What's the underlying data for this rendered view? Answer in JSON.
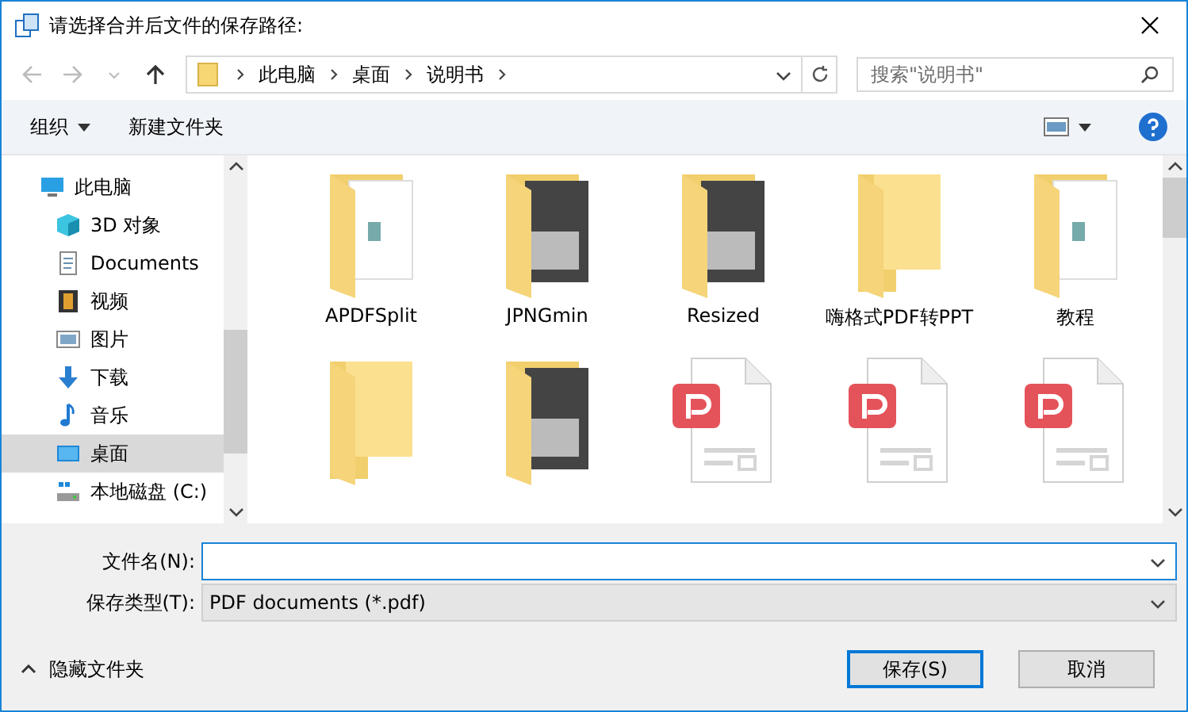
{
  "window": {
    "title": "请选择合并后文件的保存路径:"
  },
  "nav": {
    "breadcrumb": [
      "此电脑",
      "桌面",
      "说明书"
    ],
    "search": {
      "placeholder": "搜索\"说明书\""
    }
  },
  "toolbar": {
    "organize": "组织",
    "new_folder": "新建文件夹"
  },
  "sidebar": {
    "tree": [
      {
        "label": "此电脑",
        "kind": "pc",
        "selected": false,
        "children": [
          {
            "label": "3D 对象",
            "kind": "cube",
            "selected": false
          },
          {
            "label": "Documents",
            "kind": "doc",
            "selected": false
          },
          {
            "label": "视频",
            "kind": "video",
            "selected": false
          },
          {
            "label": "图片",
            "kind": "picture",
            "selected": false
          },
          {
            "label": "下载",
            "kind": "download",
            "selected": false
          },
          {
            "label": "音乐",
            "kind": "music",
            "selected": false
          },
          {
            "label": "桌面",
            "kind": "desktop",
            "selected": true
          },
          {
            "label": "本地磁盘 (C:)",
            "kind": "drive",
            "selected": false
          }
        ]
      }
    ]
  },
  "files": {
    "items": [
      {
        "name": "APDFSplit",
        "kind": "folder-docs"
      },
      {
        "name": "JPNGmin",
        "kind": "folder-photo"
      },
      {
        "name": "Resized",
        "kind": "folder-photo"
      },
      {
        "name": "嗨格式PDF转PPT",
        "kind": "folder"
      },
      {
        "name": "教程",
        "kind": "folder-docs"
      },
      {
        "kind": "folder"
      },
      {
        "kind": "folder-photo"
      },
      {
        "kind": "pdf"
      },
      {
        "kind": "pdf"
      },
      {
        "kind": "pdf"
      }
    ]
  },
  "form": {
    "filename_label": "文件名(N):",
    "type_label": "保存类型(T):",
    "type_value": "PDF documents (*.pdf)"
  },
  "footer": {
    "hide_folders": "隐藏文件夹",
    "save": "保存(S)",
    "cancel": "取消"
  }
}
